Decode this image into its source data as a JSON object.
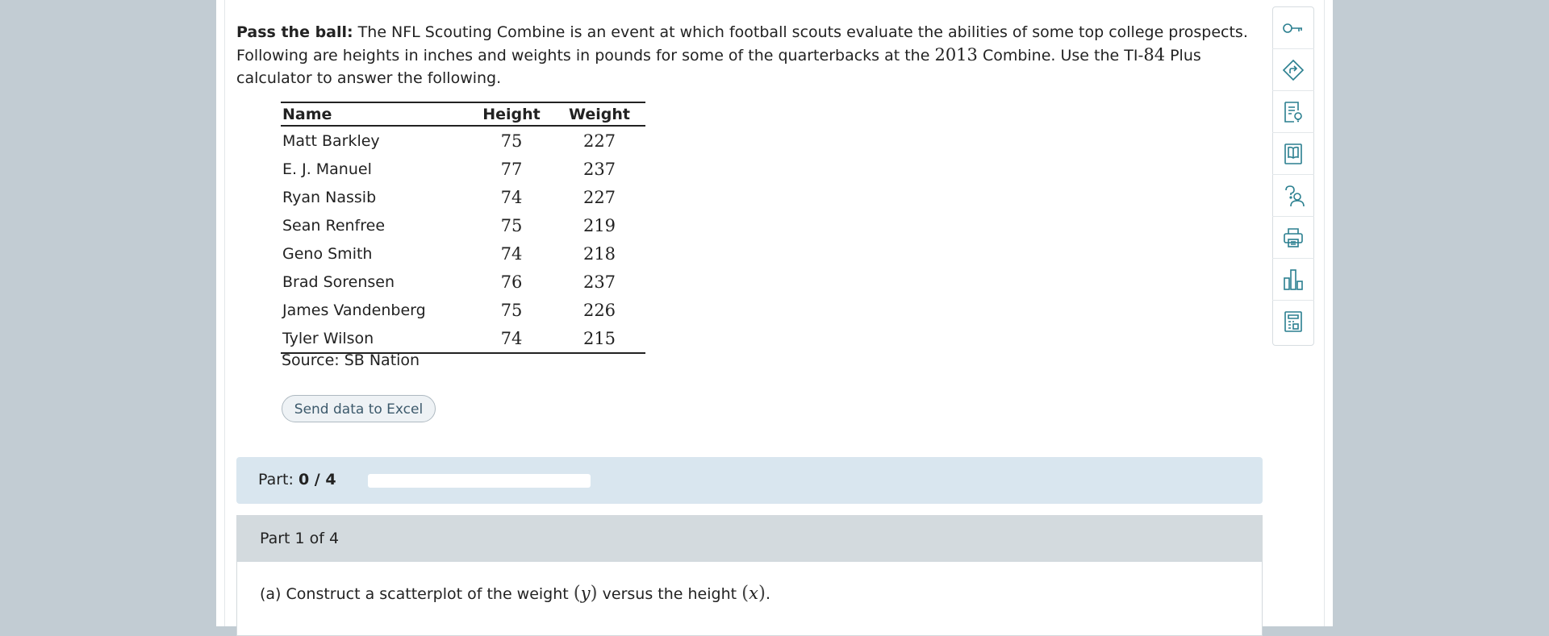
{
  "problem": {
    "title": "Pass the ball:",
    "text_1": " The NFL Scouting Combine is an event at which football scouts evaluate the abilities of some top college prospects. Following are heights in inches and weights in pounds for some of the quarterbacks at the ",
    "year": "2013",
    "text_2": " Combine. Use the TI-",
    "calc_num": "84",
    "text_3": " Plus calculator to answer the following."
  },
  "table": {
    "headers": [
      "Name",
      "Height",
      "Weight"
    ],
    "rows": [
      {
        "name": "Matt Barkley",
        "height": "75",
        "weight": "227"
      },
      {
        "name": "E. J. Manuel",
        "height": "77",
        "weight": "237"
      },
      {
        "name": "Ryan Nassib",
        "height": "74",
        "weight": "227"
      },
      {
        "name": "Sean Renfree",
        "height": "75",
        "weight": "219"
      },
      {
        "name": "Geno Smith",
        "height": "74",
        "weight": "218"
      },
      {
        "name": "Brad Sorensen",
        "height": "76",
        "weight": "237"
      },
      {
        "name": "James Vandenberg",
        "height": "75",
        "weight": "226"
      },
      {
        "name": "Tyler Wilson",
        "height": "74",
        "weight": "215"
      }
    ],
    "source": "Source: SB Nation"
  },
  "excel_button": "Send data to Excel",
  "progress": {
    "label": "Part: ",
    "value_text": "0 / 4",
    "fraction": 0
  },
  "part": {
    "header": "Part 1 of 4",
    "q_prefix": "(a) Construct a scatterplot of the weight ",
    "var_y": "y",
    "q_mid": " versus the height ",
    "var_x": "x",
    "q_end": "."
  },
  "toolbar": {
    "icons": [
      "key-icon",
      "directions-icon",
      "guided-solution-icon",
      "ebook-icon",
      "ask-help-icon",
      "print-icon",
      "statistics-icon",
      "calculator-icon"
    ]
  },
  "colors": {
    "background": "#c2ccd3",
    "accent": "#2a7f8f",
    "progress_bg": "#d9e6ef",
    "part_header_bg": "#d3dade"
  }
}
